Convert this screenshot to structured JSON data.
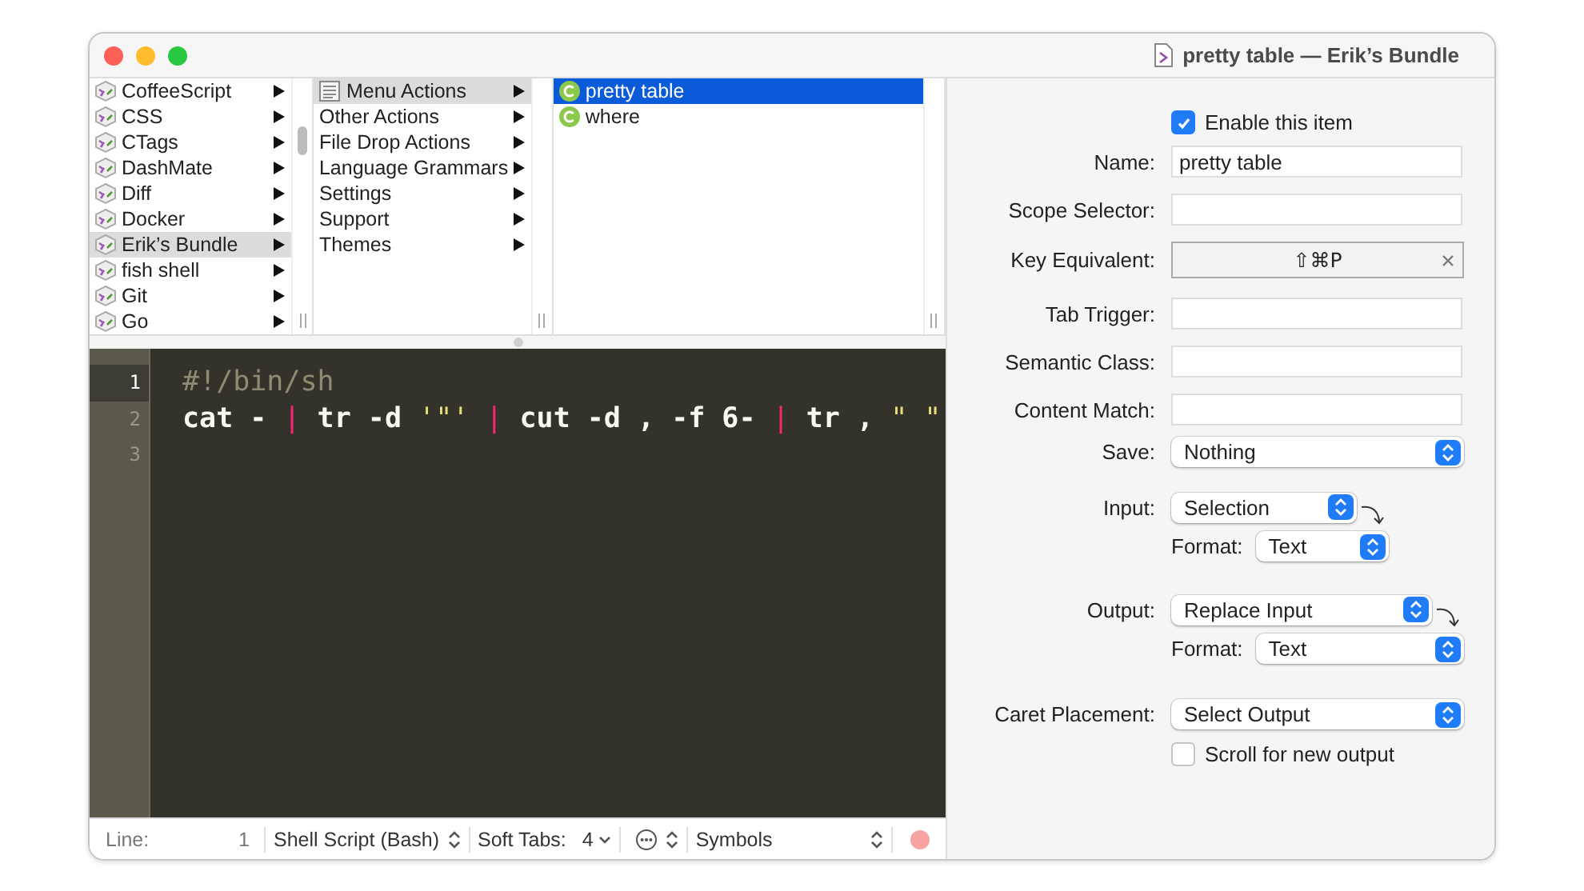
{
  "window": {
    "title": "pretty table — Erik’s Bundle"
  },
  "browser": {
    "columns": [
      {
        "active": false,
        "items": [
          {
            "label": "CoffeeScript",
            "selected": false
          },
          {
            "label": "CSS",
            "selected": false
          },
          {
            "label": "CTags",
            "selected": false
          },
          {
            "label": "DashMate",
            "selected": false
          },
          {
            "label": "Diff",
            "selected": false
          },
          {
            "label": "Docker",
            "selected": false
          },
          {
            "label": "Erik’s Bundle",
            "selected": true
          },
          {
            "label": "fish shell",
            "selected": false
          },
          {
            "label": "Git",
            "selected": false
          },
          {
            "label": "Go",
            "selected": false
          }
        ]
      },
      {
        "active": false,
        "items": [
          {
            "label": "Menu Actions",
            "selected": true
          },
          {
            "label": "Other Actions",
            "selected": false
          },
          {
            "label": "File Drop Actions",
            "selected": false
          },
          {
            "label": "Language Grammars",
            "selected": false
          },
          {
            "label": "Settings",
            "selected": false
          },
          {
            "label": "Support",
            "selected": false
          },
          {
            "label": "Themes",
            "selected": false
          }
        ]
      },
      {
        "active": true,
        "items": [
          {
            "label": "pretty table",
            "selected": true
          },
          {
            "label": "where",
            "selected": false
          }
        ]
      }
    ]
  },
  "editor": {
    "lines": [
      {
        "number": "1",
        "current": true,
        "tokens": [
          {
            "kind": "comment",
            "text": "#!/bin/sh"
          }
        ]
      },
      {
        "number": "2",
        "current": false,
        "tokens": [
          {
            "kind": "plain",
            "text": "cat - "
          },
          {
            "kind": "operator",
            "text": "|"
          },
          {
            "kind": "plain",
            "text": " tr -d "
          },
          {
            "kind": "string",
            "text": "'\"'"
          },
          {
            "kind": "operator",
            "text": " |"
          },
          {
            "kind": "plain",
            "text": " cut -d , -f 6- "
          },
          {
            "kind": "operator",
            "text": "|"
          },
          {
            "kind": "plain",
            "text": " tr , "
          },
          {
            "kind": "string",
            "text": "\" \""
          }
        ]
      },
      {
        "number": "3",
        "current": false
      }
    ]
  },
  "status_bar": {
    "line_label": "Line:",
    "line_value": "1",
    "language": "Shell Script (Bash)",
    "soft_tabs_label": "Soft Tabs:",
    "soft_tabs_value": "4",
    "symbols": "Symbols"
  },
  "properties": {
    "enable": {
      "label": "Enable this item",
      "checked": true
    },
    "fields": [
      {
        "kind": "text",
        "label": "Name:",
        "value": "pretty table"
      },
      {
        "kind": "text",
        "label": "Scope Selector:"
      },
      {
        "kind": "key",
        "label": "Key Equivalent:",
        "value": "⇧⌘P"
      },
      {
        "kind": "text",
        "label": "Tab Trigger:"
      },
      {
        "kind": "text",
        "label": "Semantic Class:"
      },
      {
        "kind": "text",
        "label": "Content Match:"
      }
    ],
    "save": {
      "label": "Save:",
      "value": "Nothing"
    },
    "input": {
      "label": "Input:",
      "value": "Selection",
      "format_label": "Format:",
      "format_value": "Text"
    },
    "output": {
      "label": "Output:",
      "value": "Replace Input",
      "format_label": "Format:",
      "format_value": "Text"
    },
    "caret": {
      "label": "Caret Placement:",
      "value": "Select Output"
    },
    "scroll": {
      "label": "Scroll for new output",
      "checked": false
    }
  }
}
